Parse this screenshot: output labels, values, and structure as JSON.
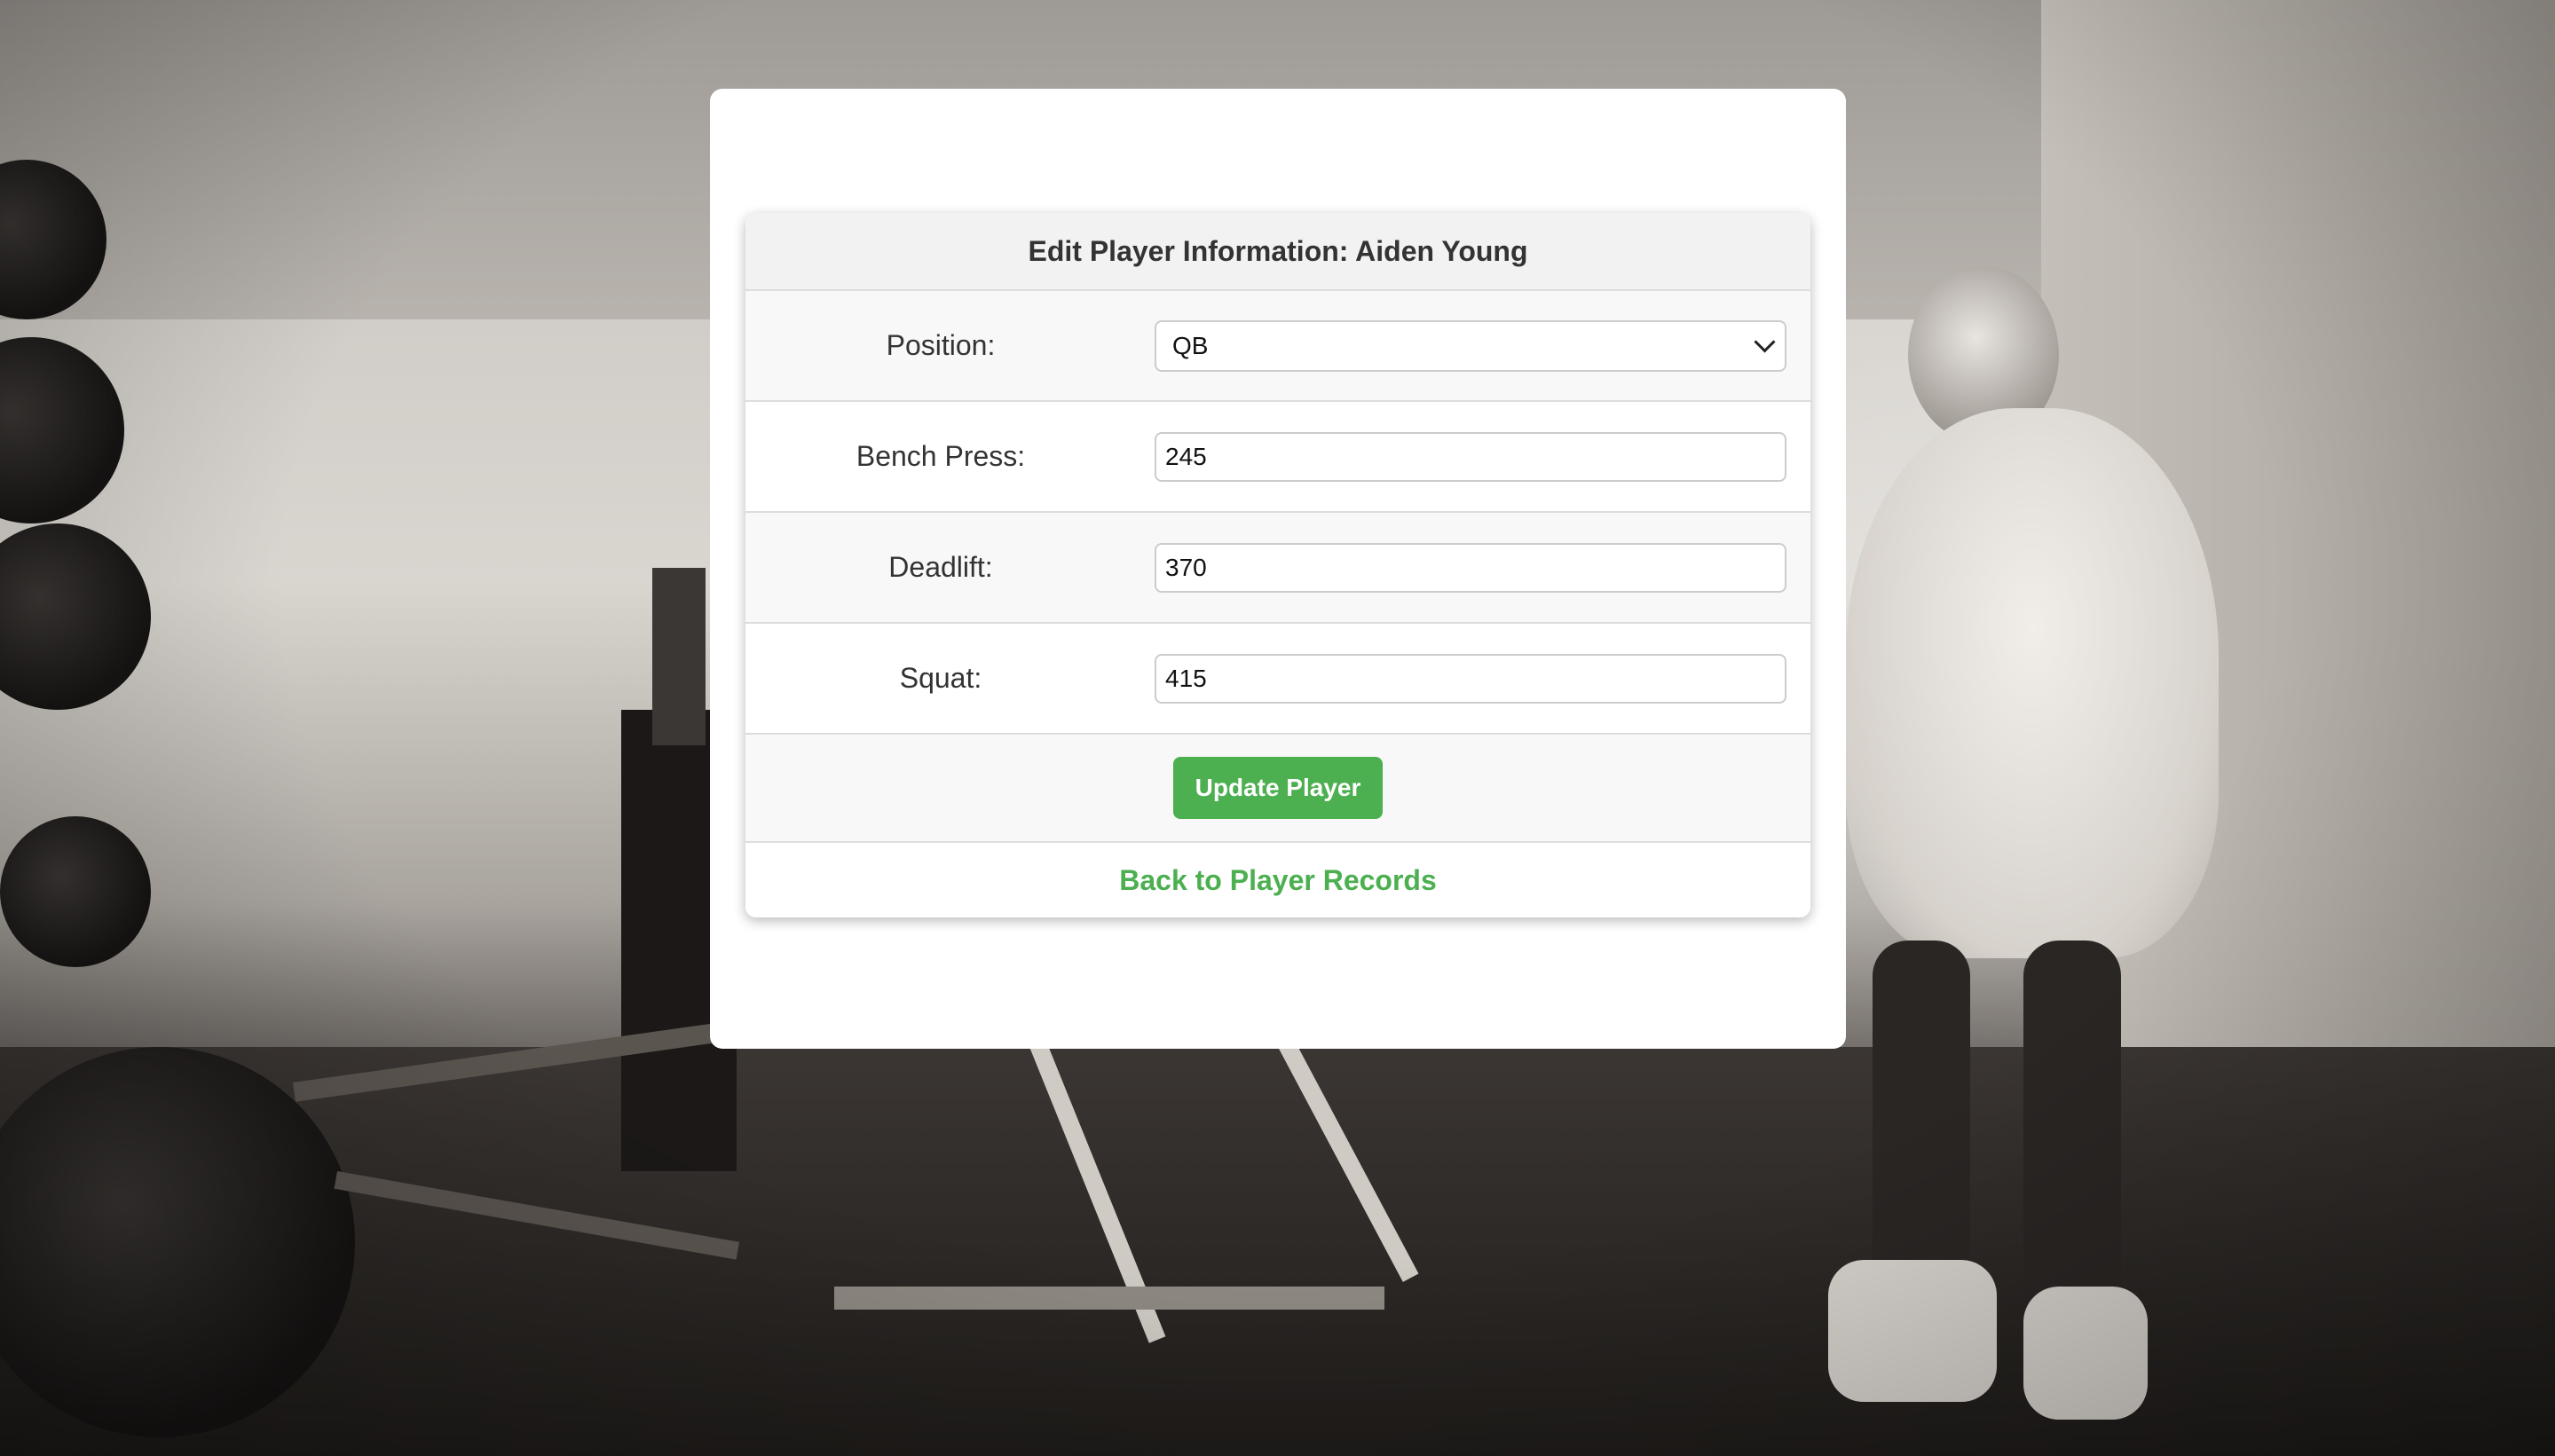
{
  "form": {
    "title": "Edit Player Information: Aiden Young",
    "fields": [
      {
        "label": "Position:",
        "type": "select",
        "value": "QB"
      },
      {
        "label": "Bench Press:",
        "type": "text",
        "value": "245"
      },
      {
        "label": "Deadlift:",
        "type": "text",
        "value": "370"
      },
      {
        "label": "Squat:",
        "type": "text",
        "value": "415"
      }
    ],
    "submit_label": "Update Player",
    "back_link_label": "Back to Player Records"
  },
  "colors": {
    "accent": "#4caf50",
    "header_bg": "#f2f2f2",
    "row_alt_bg": "#f8f8f8",
    "text": "#333333"
  },
  "icons": {
    "select_arrow": "chevron-down-icon"
  }
}
